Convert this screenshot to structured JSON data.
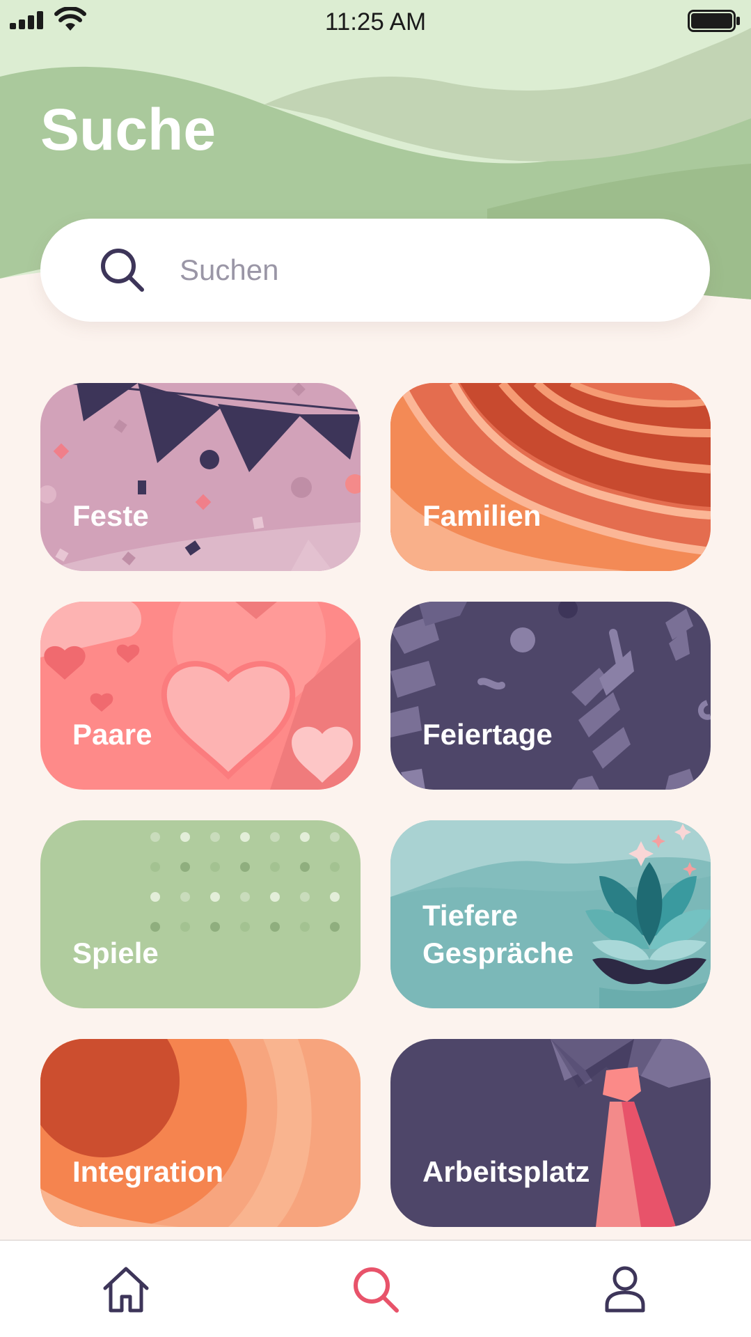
{
  "status_bar": {
    "time": "11:25 AM",
    "icons": [
      "cellular-signal-icon",
      "wifi-icon",
      "battery-icon"
    ]
  },
  "header": {
    "title": "Suche"
  },
  "search": {
    "placeholder": "Suchen",
    "icon": "search-icon"
  },
  "categories": [
    {
      "label": "Feste",
      "color": "#d2a2b9"
    },
    {
      "label": "Familien",
      "color": "#e8704a"
    },
    {
      "label": "Paare",
      "color": "#fe8a89"
    },
    {
      "label": "Feiertage",
      "color": "#4e4669"
    },
    {
      "label": "Spiele",
      "color": "#b0cc9e"
    },
    {
      "label": "Tiefere\nGespräche",
      "color": "#83bdbd"
    },
    {
      "label": "Integration",
      "color": "#f5844f"
    },
    {
      "label": "Arbeitsplatz",
      "color": "#4e4669"
    }
  ],
  "tabbar": {
    "items": [
      {
        "name": "home",
        "icon": "home-icon",
        "active": false
      },
      {
        "name": "search",
        "icon": "search-icon",
        "active": true
      },
      {
        "name": "profile",
        "icon": "user-icon",
        "active": false
      }
    ],
    "active_color": "#e8536a",
    "inactive_color": "#3d3559"
  },
  "colors": {
    "background": "#fcf3ee",
    "header_green": "#aac99c",
    "header_light": "#dcedd2"
  }
}
